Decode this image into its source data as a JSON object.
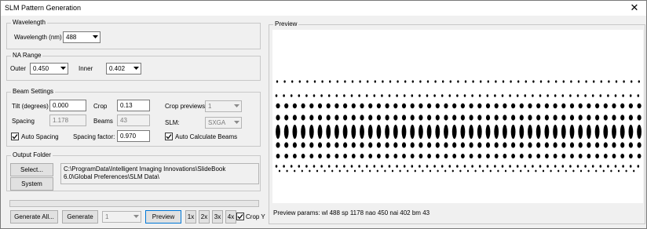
{
  "window": {
    "title": "SLM Pattern Generation"
  },
  "wavelength": {
    "group_label": "Wavelength",
    "label": "Wavelength (nm)",
    "value": "488"
  },
  "na_range": {
    "group_label": "NA Range",
    "outer_label": "Outer",
    "outer_value": "0.450",
    "inner_label": "Inner",
    "inner_value": "0.402"
  },
  "beam": {
    "group_label": "Beam Settings",
    "tilt_label": "Tilt (degrees)",
    "tilt_value": "0.000",
    "crop_label": "Crop",
    "crop_value": "0.13",
    "crop_previews_label": "Crop previews:",
    "crop_previews_value": "1",
    "spacing_label": "Spacing",
    "spacing_value": "1.178",
    "beams_label": "Beams",
    "beams_value": "43",
    "slm_label": "SLM:",
    "slm_value": "SXGA",
    "auto_spacing_label": "Auto Spacing",
    "auto_spacing_checked": true,
    "spacing_factor_label": "Spacing factor:",
    "spacing_factor_value": "0.970",
    "auto_beams_label": "Auto Calculate Beams",
    "auto_beams_checked": true
  },
  "output": {
    "group_label": "Output Folder",
    "select_label": "Select...",
    "system_label": "System",
    "path": "C:\\ProgramData\\Intelligent Imaging Innovations\\SlideBook 6.0\\Global Preferences\\SLM Data\\"
  },
  "bottom": {
    "generate_all_label": "Generate All...",
    "generate_label": "Generate",
    "count_value": "1",
    "preview_label": "Preview",
    "zoom_1": "1x",
    "zoom_2": "2x",
    "zoom_3": "3x",
    "zoom_4": "4x",
    "crop_y_label": "Crop Y",
    "crop_y_checked": true,
    "progress": 0
  },
  "preview": {
    "group_label": "Preview",
    "params": "Preview params: wl 488 sp 1178 nao 450 nai 402 bm 43"
  },
  "colors": {
    "accent": "#0078d7",
    "window_bg": "#f0f0f0",
    "border": "#adadad"
  }
}
